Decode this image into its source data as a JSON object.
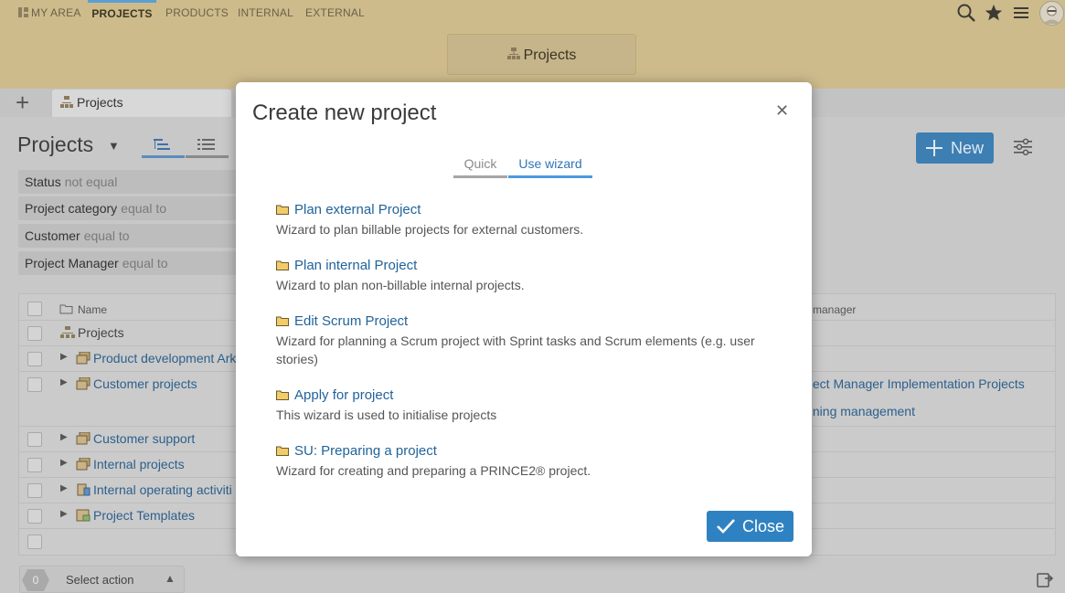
{
  "nav": {
    "items": [
      {
        "label": "MY AREA"
      },
      {
        "label": "PROJECTS"
      },
      {
        "label": "PRODUCTS"
      },
      {
        "label": "INTERNAL"
      },
      {
        "label": "EXTERNAL"
      }
    ]
  },
  "header": {
    "module_button": "Projects"
  },
  "tabs": {
    "open_tab": "Projects"
  },
  "main": {
    "title": "Projects",
    "new_button": "New",
    "filters": [
      {
        "field": "Status",
        "op": "not equal"
      },
      {
        "field": "Project category",
        "op": "equal to"
      },
      {
        "field": "Customer",
        "op": "equal to"
      },
      {
        "field": "Project Manager",
        "op": "equal to"
      }
    ],
    "table": {
      "col_name": "Name",
      "col_manager": "manager",
      "rows": [
        {
          "label": "Projects"
        },
        {
          "label": "Product development Ark"
        },
        {
          "label": "Customer projects"
        },
        {
          "label": "Customer support"
        },
        {
          "label": "Internal projects"
        },
        {
          "label": "Internal operating activiti"
        },
        {
          "label": "Project Templates"
        }
      ],
      "pm_links": [
        "oject Manager Implementation Projects",
        "aining management"
      ]
    },
    "selection_count": "0",
    "select_action": "Select action"
  },
  "modal": {
    "title": "Create new project",
    "tabs": [
      {
        "label": "Quick"
      },
      {
        "label": "Use wizard"
      }
    ],
    "wizards": [
      {
        "title": "Plan external Project",
        "desc": "Wizard to plan billable projects for external customers."
      },
      {
        "title": "Plan internal Project",
        "desc": "Wizard to plan non-billable internal projects."
      },
      {
        "title": "Edit Scrum Project",
        "desc": "Wizard for planning a Scrum project with Sprint tasks and Scrum elements (e.g. user stories)"
      },
      {
        "title": "Apply for project",
        "desc": "This wizard is used to initialise projects"
      },
      {
        "title": "SU: Preparing a project",
        "desc": "Wizard for creating and preparing a PRINCE2® project."
      }
    ],
    "close_button": "Close"
  },
  "colors": {
    "header_bg": "#cdbb8c",
    "accent": "#2f82c2",
    "link": "#21639a"
  }
}
